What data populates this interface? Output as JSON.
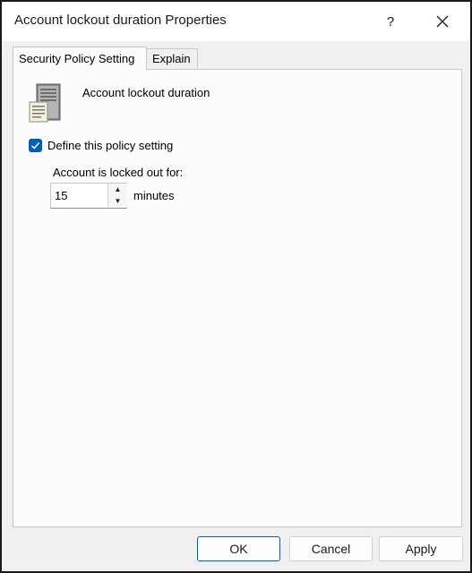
{
  "window": {
    "title": "Account lockout duration Properties",
    "help_label": "?",
    "close_label": "✕"
  },
  "tabs": [
    {
      "label": "Security Policy Setting",
      "active": true
    },
    {
      "label": "Explain",
      "active": false
    }
  ],
  "policy": {
    "icon": "server-policy-icon",
    "name": "Account lockout duration",
    "define_label": "Define this policy setting",
    "define_checked": true,
    "locked_label": "Account is locked out for:",
    "duration_value": "15",
    "unit_label": "minutes"
  },
  "buttons": {
    "ok": "OK",
    "cancel": "Cancel",
    "apply": "Apply"
  },
  "colors": {
    "accent": "#005fb8",
    "dialog_bg": "#f0f0f0",
    "panel_bg": "#fcfcfc"
  }
}
